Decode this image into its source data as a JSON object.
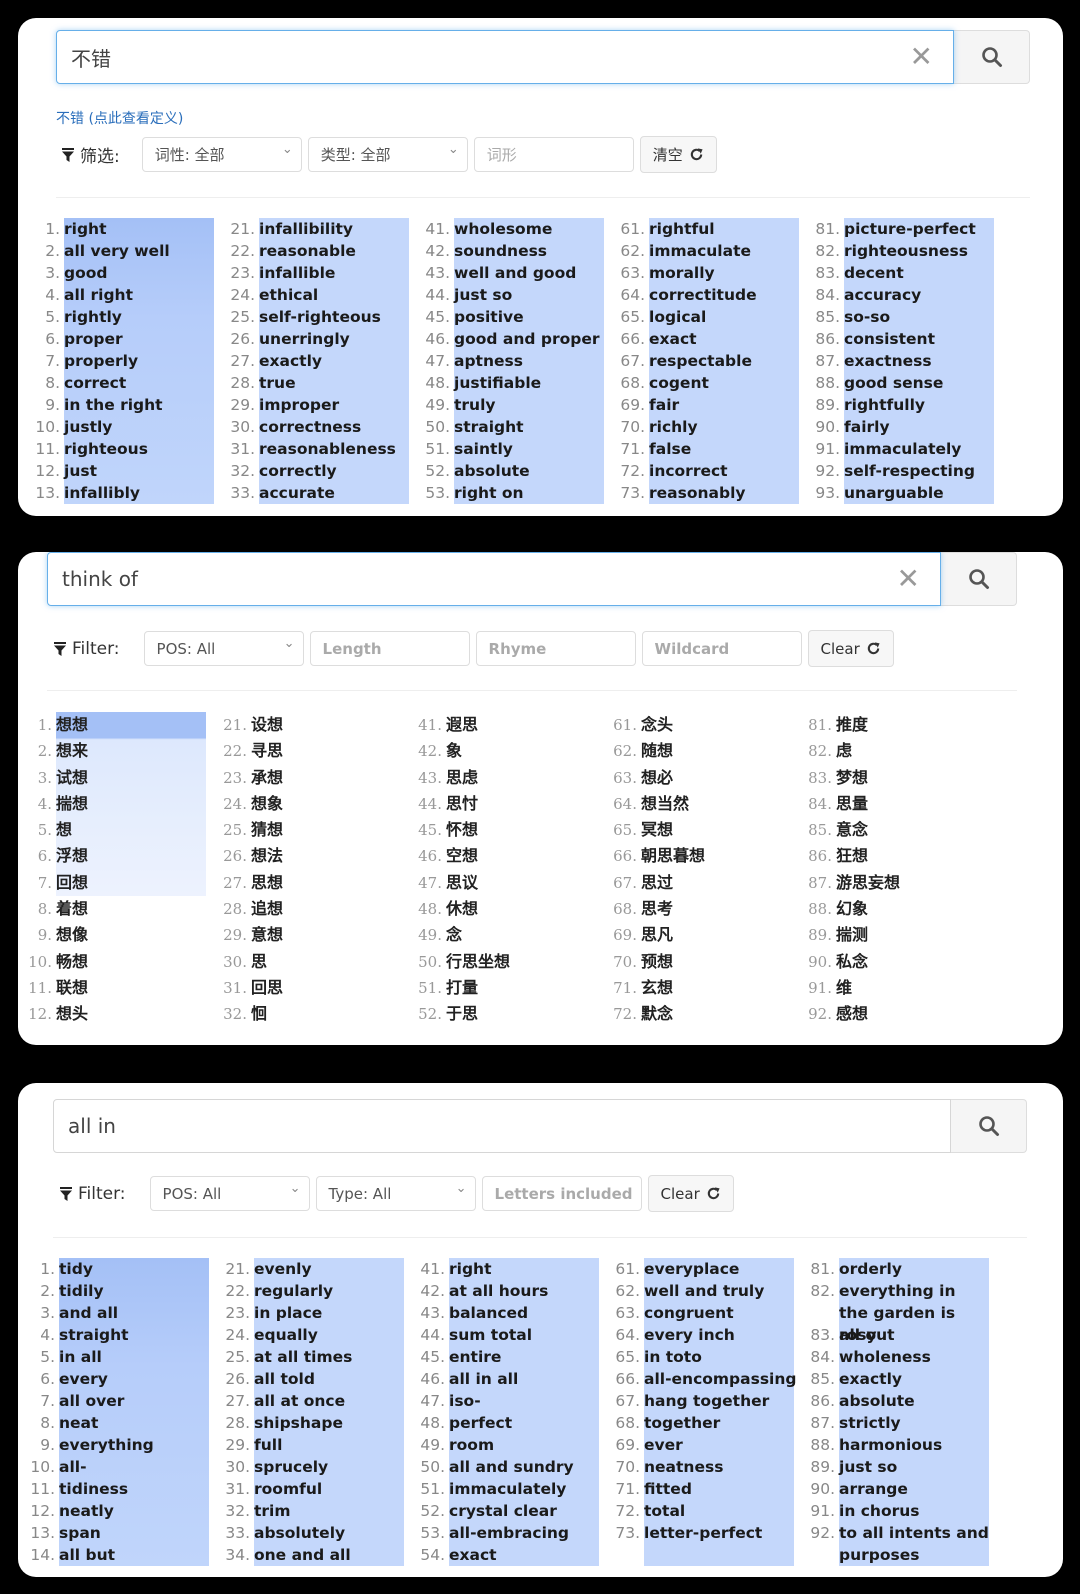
{
  "panels": [
    {
      "search": {
        "value": "不错",
        "clear_icon": "close-icon",
        "search_icon": "search-icon"
      },
      "definition_link": "不错 (点此查看定义)",
      "filter": {
        "label": "筛选:",
        "controls": [
          {
            "kind": "select",
            "value": "词性: 全部"
          },
          {
            "kind": "select",
            "value": "类型: 全部"
          },
          {
            "kind": "input",
            "placeholder": "词形"
          }
        ],
        "clear_button": "清空"
      },
      "results": [
        [
          "right",
          "all very well",
          "good",
          "all right",
          "rightly",
          "proper",
          "properly",
          "correct",
          "in the right",
          "justly",
          "righteous",
          "just",
          "infallibly"
        ],
        [
          "infallibility",
          "reasonable",
          "infallible",
          "ethical",
          "self-righteous",
          "unerringly",
          "exactly",
          "true",
          "improper",
          "correctness",
          "reasonableness",
          "correctly",
          "accurate"
        ],
        [
          "wholesome",
          "soundness",
          "well and good",
          "just so",
          "positive",
          "good and proper",
          "aptness",
          "justifiable",
          "truly",
          "straight",
          "saintly",
          "absolute",
          "right on"
        ],
        [
          "rightful",
          "immaculate",
          "morally",
          "correctitude",
          "logical",
          "exact",
          "respectable",
          "cogent",
          "fair",
          "richly",
          "false",
          "incorrect",
          "reasonably"
        ],
        [
          "picture-perfect",
          "righteousness",
          "decent",
          "accuracy",
          "so-so",
          "consistent",
          "exactness",
          "good sense",
          "rightfully",
          "fairly",
          "immaculately",
          "self-respecting",
          "unarguable"
        ]
      ],
      "column_start_numbers": [
        1,
        21,
        41,
        61,
        81
      ]
    },
    {
      "search": {
        "value": "think of",
        "clear_icon": "close-icon",
        "search_icon": "search-icon"
      },
      "filter": {
        "label": "Filter:",
        "controls": [
          {
            "kind": "select",
            "value": "POS: All"
          },
          {
            "kind": "input",
            "placeholder": "Length"
          },
          {
            "kind": "input",
            "placeholder": "Rhyme"
          },
          {
            "kind": "input",
            "placeholder": "Wildcard"
          }
        ],
        "clear_button": "Clear"
      },
      "results": [
        [
          "想想",
          "想来",
          "试想",
          "揣想",
          "想",
          "浮想",
          "回想",
          "着想",
          "想像",
          "畅想",
          "联想",
          "想头"
        ],
        [
          "设想",
          "寻思",
          "承想",
          "想象",
          "猜想",
          "想法",
          "思想",
          "追想",
          "意想",
          "思",
          "回思",
          "恛"
        ],
        [
          "遐思",
          "象",
          "思虑",
          "思忖",
          "怀想",
          "空想",
          "思议",
          "休想",
          "念",
          "行思坐想",
          "打量",
          "于思"
        ],
        [
          "念头",
          "随想",
          "想必",
          "想当然",
          "冥想",
          "朝思暮想",
          "思过",
          "思考",
          "思凡",
          "预想",
          "玄想",
          "默念"
        ],
        [
          "推度",
          "虑",
          "梦想",
          "思量",
          "意念",
          "狂想",
          "游思妄想",
          "幻象",
          "揣测",
          "私念",
          "维",
          "感想"
        ]
      ],
      "column_start_numbers": [
        1,
        21,
        41,
        61,
        81
      ],
      "highlighted_count": 7
    },
    {
      "search": {
        "value": "all in",
        "search_icon": "search-icon"
      },
      "filter": {
        "label": "Filter:",
        "controls": [
          {
            "kind": "select",
            "value": "POS: All"
          },
          {
            "kind": "select",
            "value": "Type: All"
          },
          {
            "kind": "input",
            "placeholder": "Letters included"
          }
        ],
        "clear_button": "Clear"
      },
      "results": [
        [
          "tidy",
          "tidily",
          "and all",
          "straight",
          "in all",
          "every",
          "all over",
          "neat",
          "everything",
          "all-",
          "tidiness",
          "neatly",
          "span",
          "all but"
        ],
        [
          "evenly",
          "regularly",
          "in place",
          "equally",
          "at all times",
          "all told",
          "all at once",
          "shipshape",
          "full",
          "sprucely",
          "roomful",
          "trim",
          "absolutely",
          "one and all"
        ],
        [
          "right",
          "at all hours",
          "balanced",
          "sum total",
          "entire",
          "all in all",
          "iso-",
          "perfect",
          "room",
          "all and sundry",
          "immaculately",
          "crystal clear",
          "all-embracing",
          "exact"
        ],
        [
          "everyplace",
          "well and truly",
          "congruent",
          "every inch",
          "in toto",
          "all-encompassing",
          "hang together",
          "together",
          "ever",
          "neatness",
          "fitted",
          "total",
          "letter-perfect"
        ],
        [
          "orderly",
          "everything in the garden is rosy",
          "all out",
          "wholeness",
          "exactly",
          "absolute",
          "strictly",
          "harmonious",
          "just so",
          "arrange",
          "in chorus",
          "to all intents and purposes"
        ]
      ],
      "column_start_numbers": [
        1,
        21,
        41,
        61,
        81
      ]
    }
  ],
  "colors": {
    "highlight": "#c4d7fb",
    "highlight_strong": "#a4c0f6",
    "focus_border": "#66afe9",
    "link": "#2a6ebb"
  }
}
